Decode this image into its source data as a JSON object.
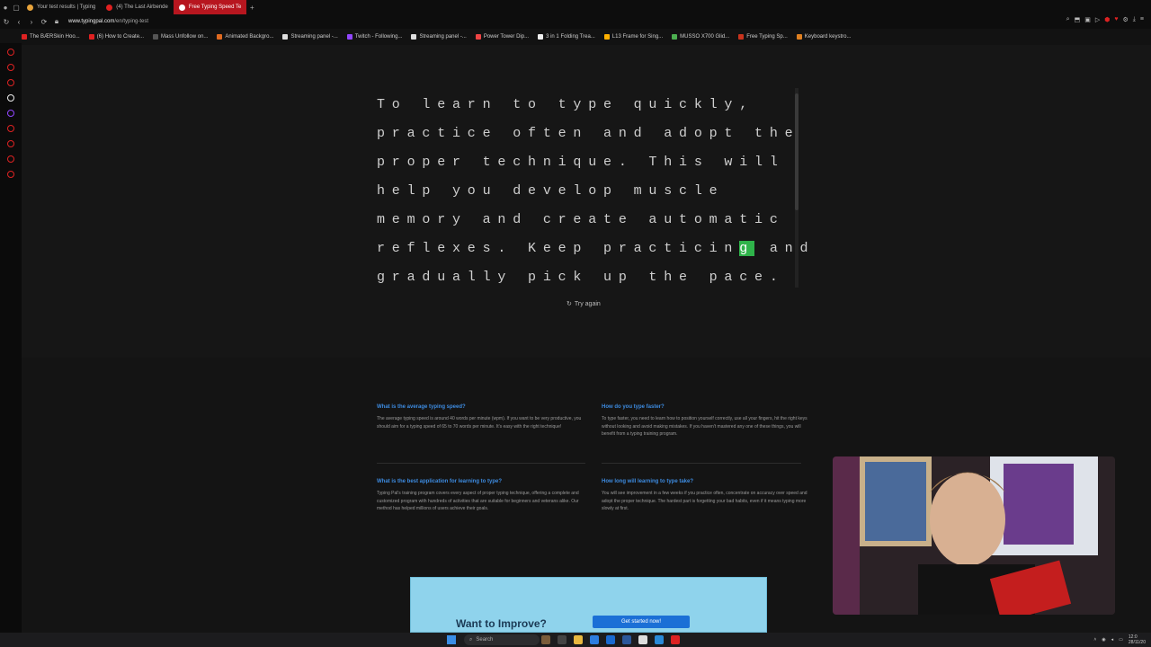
{
  "browser": {
    "tabs": [
      {
        "label": "Your test results | Typing",
        "color": "#e8a33b",
        "active": false
      },
      {
        "label": "(4) The Last Airbende",
        "color": "#e02020",
        "active": false
      },
      {
        "label": "Free Typing Speed Te",
        "color": "#c8331d",
        "active": true
      }
    ],
    "new_tab": "+",
    "url_domain": "www.typingpal.com",
    "url_path": "/en/typing-test",
    "bookmarks": [
      {
        "label": "The BÆRSkin Hoo...",
        "color": "#d22"
      },
      {
        "label": "(6) How to Create...",
        "color": "#e02020"
      },
      {
        "label": "Mass Unfollow on...",
        "color": "#555"
      },
      {
        "label": "Animated Backgro...",
        "color": "#e06a20"
      },
      {
        "label": "Streaming panel -...",
        "color": "#ddd"
      },
      {
        "label": "Twitch - Following...",
        "color": "#9146ff"
      },
      {
        "label": "Streaming panel -...",
        "color": "#ddd"
      },
      {
        "label": "Power Tower Dip...",
        "color": "#e44"
      },
      {
        "label": "3 in 1 Folding Trea...",
        "color": "#eee"
      },
      {
        "label": "L13 Frame for Sing...",
        "color": "#ffb000"
      },
      {
        "label": "MUSSO X700 Glid...",
        "color": "#4caf50"
      },
      {
        "label": "Free Typing Sp...",
        "color": "#c8331d"
      },
      {
        "label": "Keyboard keystro...",
        "color": "#e08020"
      }
    ]
  },
  "typing": {
    "lines": [
      {
        "pre": "To learn to type quickly,",
        "cur": "",
        "post": ""
      },
      {
        "pre": "practice often and adopt the",
        "cur": "",
        "post": ""
      },
      {
        "pre": "proper technique. This will",
        "cur": "",
        "post": ""
      },
      {
        "pre": "help you develop muscle",
        "cur": "",
        "post": ""
      },
      {
        "pre": "memory and create automatic",
        "cur": "",
        "post": ""
      },
      {
        "pre": "reflexes. Keep practicin",
        "cur": "g",
        "post": " and"
      },
      {
        "pre": "gradually pick up the pace.",
        "cur": "",
        "post": ""
      }
    ],
    "try_again": "Try again"
  },
  "faq": [
    {
      "q": "What is the average typing speed?",
      "a": "The average typing speed is around 40 words per minute (wpm). If you want to be very productive, you should aim for a typing speed of 65 to 70 words per minute. It's easy with the right technique!"
    },
    {
      "q": "How do you type faster?",
      "a": "To type faster, you need to learn how to position yourself correctly, use all your fingers, hit the right keys without looking and avoid making mistakes. If you haven't mastered any one of these things, you will benefit from a typing training program."
    },
    {
      "q": "What is the best application for learning to type?",
      "a": "Typing Pal's training program covers every aspect of proper typing technique, offering a complete and customized program with hundreds of activities that are suitable for beginners and veterans alike. Our method has helped millions of users achieve their goals."
    },
    {
      "q": "How long will learning to type take?",
      "a": "You will see improvement in a few weeks if you practice often, concentrate on accuracy over speed and adopt the proper technique. The hardest part is forgetting your bad habits, even if it means typing more slowly at first."
    }
  ],
  "cta": {
    "title": "Want to Improve?",
    "button": "Get started now!"
  },
  "taskbar": {
    "search_label": "Search",
    "time": "12:0",
    "date": "28/11/20"
  }
}
